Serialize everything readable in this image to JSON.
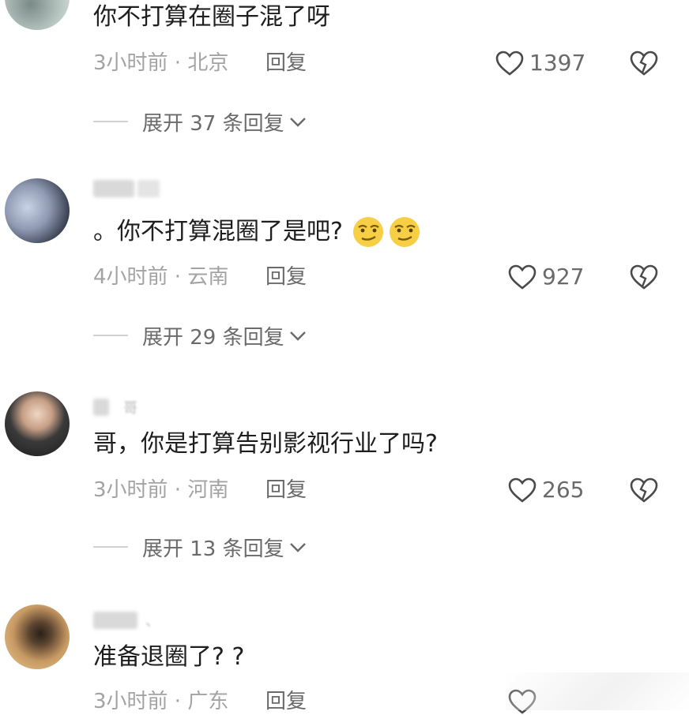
{
  "comments": [
    {
      "text": "你不打算在圈子混了呀",
      "time_location": "3小时前 · 北京",
      "reply_label": "回复",
      "likes": "1397",
      "expand_label": "展开 37 条回复"
    },
    {
      "text": "。你不打算混圈了是吧?",
      "time_location": "4小时前 · 云南",
      "reply_label": "回复",
      "likes": "927",
      "expand_label": "展开 29 条回复"
    },
    {
      "text": "哥，你是打算告别影视行业了吗?",
      "username_visible": "哥",
      "time_location": "3小时前 · 河南",
      "reply_label": "回复",
      "likes": "265",
      "expand_label": "展开 13 条回复"
    },
    {
      "text": "准备退圈了? ?",
      "username_visible": "、",
      "time_location": "3小时前 · 广东",
      "reply_label": "回复"
    }
  ],
  "icons": {
    "like": "heart-outline-icon",
    "dislike": "broken-heart-icon",
    "expand": "chevron-down-icon",
    "emoji": "smirk-face-emoji"
  },
  "colors": {
    "text": "#1e1e1e",
    "meta": "#a3a3a3",
    "action": "#6a6a6a",
    "emoji": "#f4c430"
  }
}
